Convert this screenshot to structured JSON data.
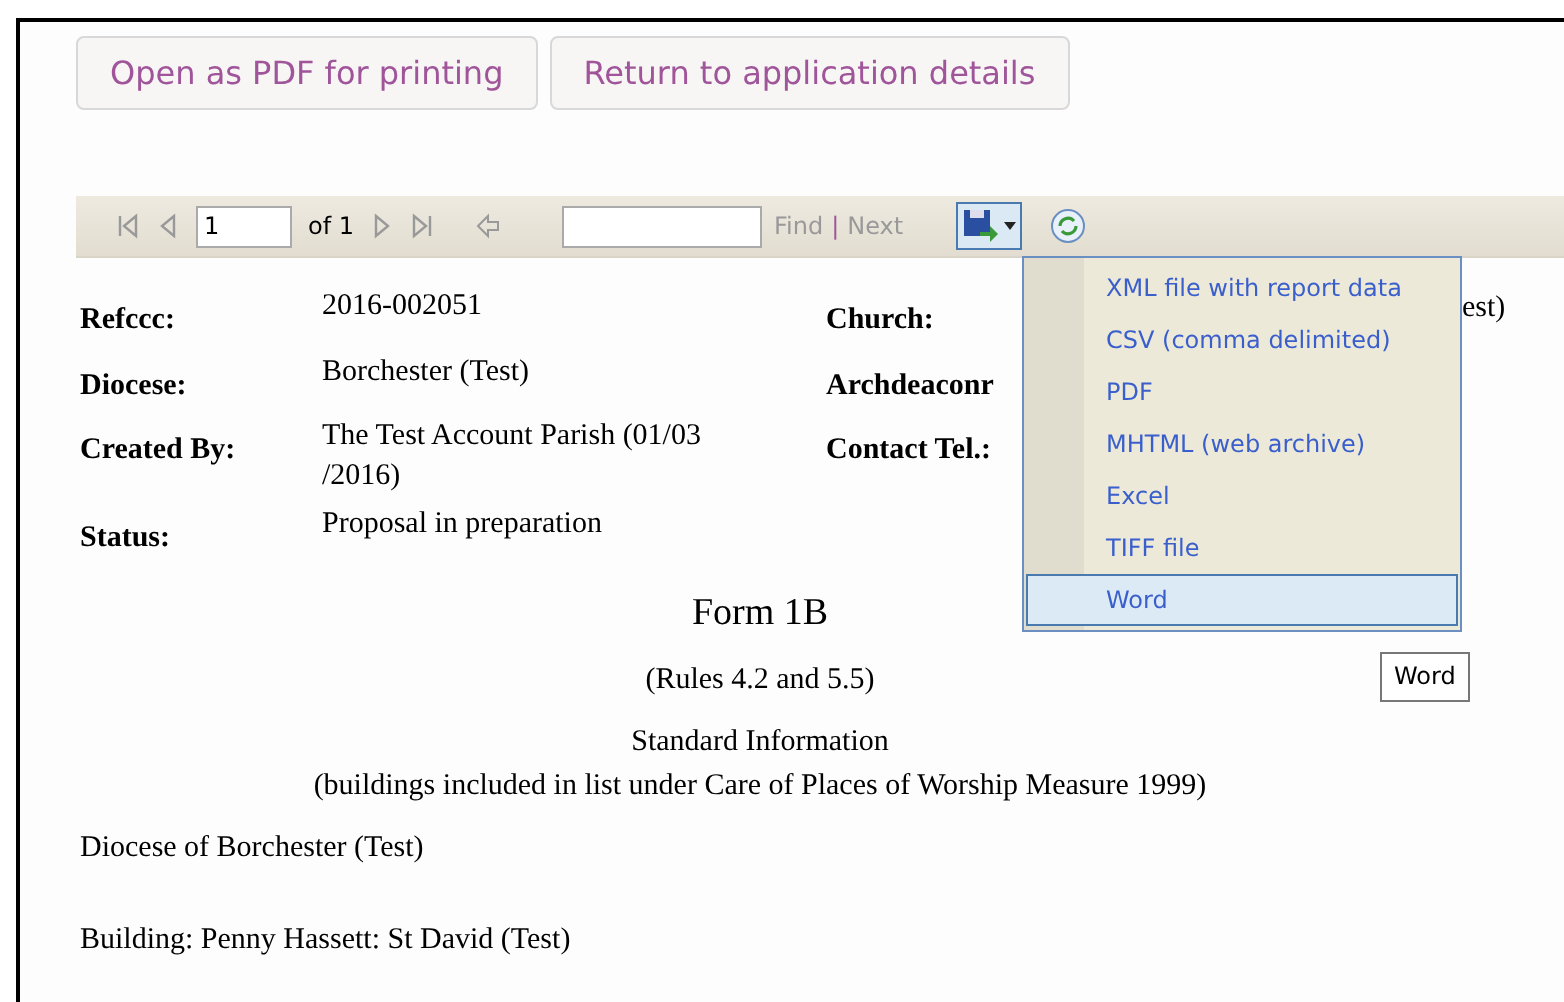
{
  "buttons": [
    {
      "label": "Open as PDF for printing"
    },
    {
      "label": "Return to application details"
    }
  ],
  "toolbar": {
    "page": "1",
    "page_count": "of 1",
    "find_label": "Find",
    "separator": "|",
    "next_label": "Next",
    "export_expanded": true
  },
  "export_menu": [
    {
      "label": "XML file with report data",
      "selected": false
    },
    {
      "label": "CSV (comma delimited)",
      "selected": false
    },
    {
      "label": "PDF",
      "selected": false
    },
    {
      "label": "MHTML (web archive)",
      "selected": false
    },
    {
      "label": "Excel",
      "selected": false
    },
    {
      "label": "TIFF file",
      "selected": false
    },
    {
      "label": "Word",
      "selected": true
    }
  ],
  "tooltip": "Word",
  "details": [
    {
      "label": "Refccc:",
      "value": "2016-002051",
      "label_2": "Church:",
      "value_2": "est)"
    },
    {
      "label": "Diocese:",
      "value": "Borchester (Test)",
      "label_2": "Archdeaconr"
    },
    {
      "label": "Created By:",
      "value": "The Test Account Parish (01/03 /2016)",
      "label_2": "Contact Tel.:"
    },
    {
      "label": "Status:",
      "value": "Proposal in preparation"
    }
  ],
  "form": {
    "title": "Form 1B",
    "rules": "(Rules 4.2 and 5.5)",
    "subtitle": "Standard Information",
    "note": "(buildings included in list under Care of Places of Worship Measure 1999)",
    "diocese": "Diocese of Borchester (Test)",
    "building": "Building: Penny Hassett: St David (Test)"
  }
}
